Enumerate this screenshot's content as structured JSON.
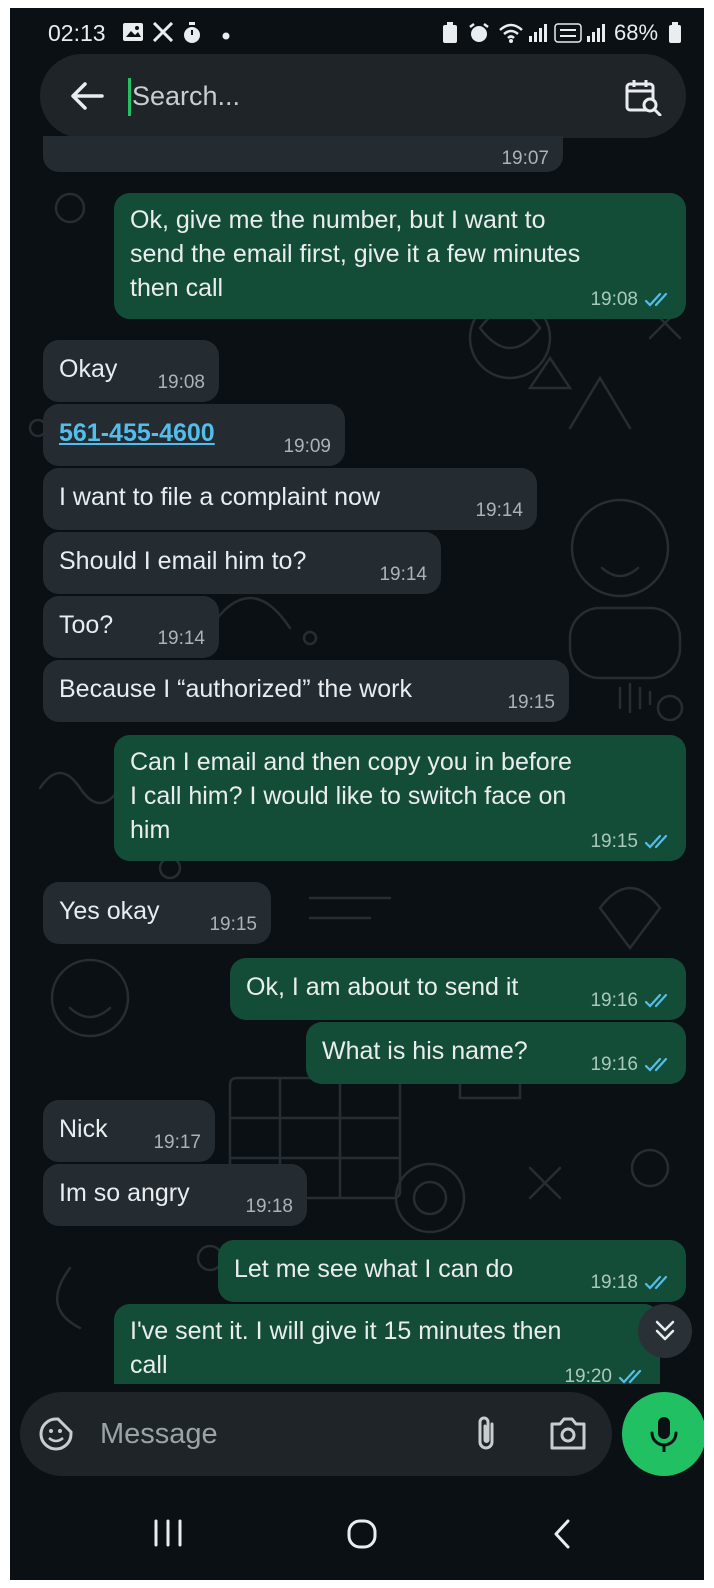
{
  "status_bar": {
    "time": "02:13",
    "battery": "68%"
  },
  "search": {
    "placeholder": "Search..."
  },
  "partial_time": "19:07",
  "messages": [
    {
      "dir": "out",
      "text": "Ok, give me the number, but I want to\nsend the email first, give it a few minutes\nthen call",
      "time": "19:08"
    },
    {
      "dir": "in",
      "text": "Okay",
      "time": "19:08"
    },
    {
      "dir": "in",
      "text": "561-455-4600",
      "time": "19:09"
    },
    {
      "dir": "in",
      "text": "I want to file a complaint now",
      "time": "19:14"
    },
    {
      "dir": "in",
      "text": "Should I email him to?",
      "time": "19:14"
    },
    {
      "dir": "in",
      "text": "Too?",
      "time": "19:14"
    },
    {
      "dir": "in",
      "text": "Because I “authorized” the work",
      "time": "19:15"
    },
    {
      "dir": "out",
      "text": "Can I email and then copy you in before\nI call him? I would like to switch face on\nhim",
      "time": "19:15"
    },
    {
      "dir": "in",
      "text": "Yes okay",
      "time": "19:15"
    },
    {
      "dir": "out",
      "text": "Ok, I am about to send it",
      "time": "19:16"
    },
    {
      "dir": "out",
      "text": "What is his name?",
      "time": "19:16"
    },
    {
      "dir": "in",
      "text": "Nick",
      "time": "19:17"
    },
    {
      "dir": "in",
      "text": "Im so angry",
      "time": "19:18"
    },
    {
      "dir": "out",
      "text": "Let me see what I can do",
      "time": "19:18"
    },
    {
      "dir": "out",
      "text": "I've sent it. I will give it 15 minutes then\ncall",
      "time": "19:20"
    }
  ],
  "composer": {
    "placeholder": "Message"
  },
  "colors": {
    "outgoing": "#144d37",
    "incoming": "#242b31",
    "accent": "#21c063",
    "read_tick": "#53bdeb"
  }
}
